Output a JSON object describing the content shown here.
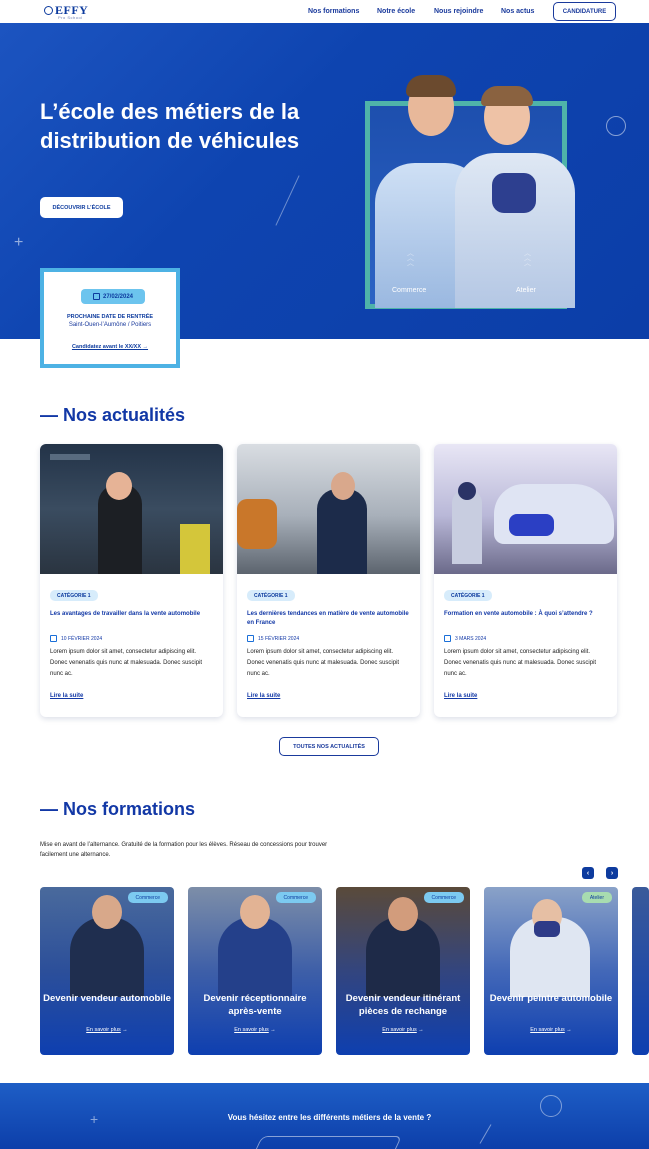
{
  "nav": {
    "logo": "EFFY",
    "logo_sub": "Pro School",
    "links": [
      "Nos formations",
      "Notre école",
      "Nous rejoindre",
      "Nos actus"
    ],
    "cta": "CANDIDATURE"
  },
  "hero": {
    "title": "L’école des métiers de la distribution de véhicules",
    "button": "DÉCOUVRIR L’ÉCOLE",
    "photo_labels": [
      "Commerce",
      "Atelier"
    ],
    "rentree": {
      "date": "27/02/2024",
      "title": "PROCHAINE DATE DE RENTRÉE",
      "location": "Saint-Ouen-l’Aumône / Poitiers",
      "link": "Candidatez avant le XX/XX",
      "link_arrow": "→"
    }
  },
  "news": {
    "title": "— Nos actualités",
    "cards": [
      {
        "tag": "CATÉGORIE 1",
        "title": "Les avantages de travailler dans la vente automobile",
        "date": "10 FÉVRIER 2024",
        "text": "Lorem ipsum dolor sit amet, consectetur adipiscing elit. Donec venenatis quis nunc at malesuada. Donec suscipit nunc ac.",
        "link": "Lire la suite"
      },
      {
        "tag": "CATÉGORIE 1",
        "title": "Les dernières tendances en matière de vente automobile en France",
        "date": "15 FÉVRIER 2024",
        "text": "Lorem ipsum dolor sit amet, consectetur adipiscing elit. Donec venenatis quis nunc at malesuada. Donec suscipit nunc ac.",
        "link": "Lire la suite"
      },
      {
        "tag": "CATÉGORIE 1",
        "title": "Formation en vente automobile : À quoi s’attendre ?",
        "date": "3 MARS 2024",
        "text": "Lorem ipsum dolor sit amet, consectetur adipiscing elit. Donec venenatis quis nunc at malesuada. Donec suscipit nunc ac.",
        "link": "Lire la suite"
      }
    ],
    "all_button": "TOUTES NOS ACTUALITÉS"
  },
  "formations": {
    "title": "— Nos formations",
    "description": "Mise en avant de l’alternance. Gratuité de la formation pour les élèves. Réseau de concessions pour trouver facilement une alternance.",
    "prev": "‹",
    "next": "›",
    "cards": [
      {
        "badge": "Commerce",
        "title": "Devenir vendeur automobile",
        "link": "En savoir plus",
        "arrow": "→"
      },
      {
        "badge": "Commerce",
        "title": "Devenir réceptionnaire après-vente",
        "link": "En savoir plus",
        "arrow": "→"
      },
      {
        "badge": "Commerce",
        "title": "Devenir vendeur itinérant pièces de rechange",
        "link": "En savoir plus",
        "arrow": "→"
      },
      {
        "badge": "Atelier",
        "title": "Devenir peintre automobile",
        "link": "En savoir plus",
        "arrow": "→"
      }
    ]
  },
  "band": {
    "text": "Vous hésitez entre les différents métiers de la vente ?"
  },
  "colors": {
    "brand_blue": "#1238a6",
    "hero_blue": "#0e44b0",
    "accent_light_blue": "#4db2e4",
    "badge_commerce": "#7ccaf0",
    "badge_atelier": "#a8dcb0"
  }
}
